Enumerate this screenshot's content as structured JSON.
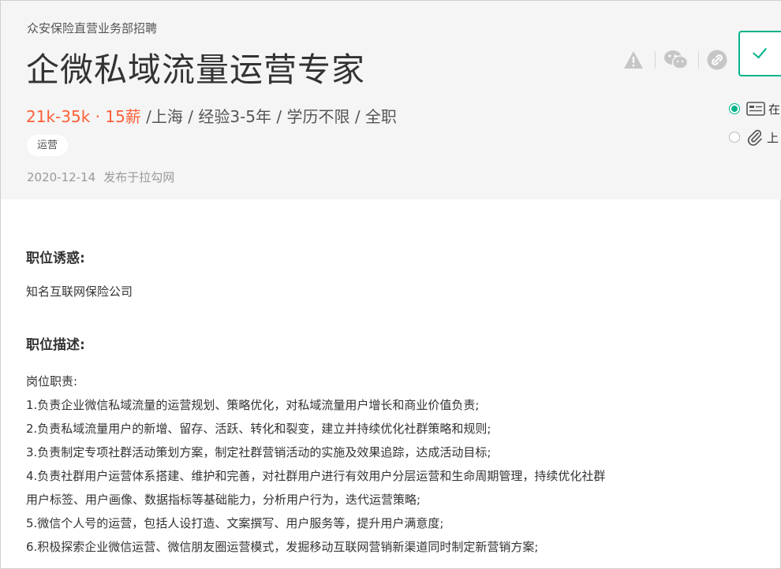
{
  "header": {
    "department": "众安保险直营业务部招聘",
    "title": "企微私域流量运营专家",
    "salary": "21k-35k · 15薪",
    "meta_rest": " /上海 / 经验3-5年 / 学历不限 / 全职",
    "tag": "运营",
    "publish_date": "2020-12-14",
    "publish_source": "发布于拉勾网"
  },
  "actions": {
    "options": [
      {
        "label": "在",
        "icon": "resume-card-icon",
        "checked": true
      },
      {
        "label": "上",
        "icon": "paperclip-icon",
        "checked": false
      }
    ]
  },
  "content": {
    "perks_title": "职位诱惑:",
    "perks_text": "知名互联网保险公司",
    "desc_title": "职位描述:",
    "desc_lines": [
      "岗位职责:",
      "1.负责企业微信私域流量的运营规划、策略优化，对私域流量用户增长和商业价值负责;",
      "2.负责私域流量用户的新增、留存、活跃、转化和裂变，建立并持续优化社群策略和规则;",
      "3.负责制定专项社群活动策划方案，制定社群营销活动的实施及效果追踪，达成活动目标;",
      "4.负责社群用户运营体系搭建、维护和完善，对社群用户进行有效用户分层运营和生命周期管理，持续优化社群",
      "用户标签、用户画像、数据指标等基础能力，分析用户行为，迭代运营策略;",
      "5.微信个人号的运营，包括人设打造、文案撰写、用户服务等，提升用户满意度;",
      "6.积极探索企业微信运营、微信朋友圈运营模式，发掘移动互联网营销新渠道同时制定新营销方案;"
    ]
  },
  "colors": {
    "accent": "#00b38a",
    "salary": "#fd5f39"
  }
}
